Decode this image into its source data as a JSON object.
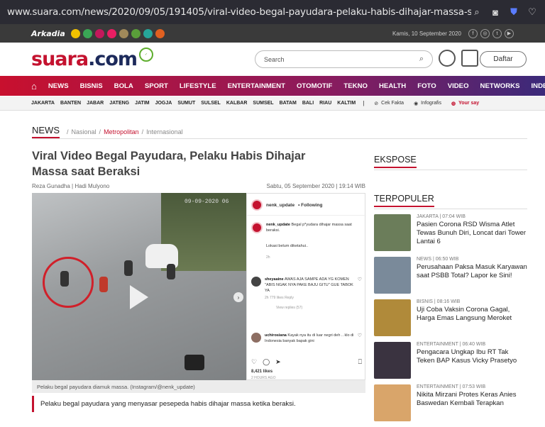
{
  "browser": {
    "url": "www.suara.com/news/2020/09/05/191405/viral-video-begal-payudara-pelaku-habis-dihajar-massa-saat-beraksi"
  },
  "topstrip": {
    "network": "Arkadia",
    "network_sub": "digital media",
    "date": "Kamis, 10 September 2020"
  },
  "header": {
    "logo_main": "suara",
    "logo_dot": ".com",
    "search_placeholder": "Search",
    "daftar_label": "Daftar"
  },
  "nav": {
    "items": [
      "NEWS",
      "BISNIS",
      "BOLA",
      "SPORT",
      "LIFESTYLE",
      "ENTERTAINMENT",
      "OTOMOTIF",
      "TEKNO",
      "HEALTH",
      "FOTO",
      "VIDEO",
      "NETWORKS",
      "INDEKS"
    ]
  },
  "subnav": {
    "regions": [
      "JAKARTA",
      "BANTEN",
      "JABAR",
      "JATENG",
      "JATIM",
      "JOGJA",
      "SUMUT",
      "SULSEL",
      "KALBAR",
      "SUMSEL",
      "BATAM",
      "BALI",
      "RIAU",
      "KALTIM"
    ],
    "cek_fakta": "Cek Fakta",
    "infografis": "Infografis",
    "your_say": "Your say"
  },
  "breadcrumb": {
    "main": "NEWS",
    "items": [
      "Nasional",
      "Metropolitan",
      "Internasional"
    ]
  },
  "article": {
    "title": "Viral Video Begal Payudara, Pelaku Habis Dihajar Massa saat Beraksi",
    "authors": "Reza Gunadha | Hadi Mulyono",
    "date": "Sabtu, 05 September 2020 | 19:14 WIB",
    "caption": "Pelaku begal payudara diamuk massa. (Instagram/@nenk_update)",
    "lead": "Pelaku begal payudara yang menyasar pesepeda habis dihajar massa ketika beraksi."
  },
  "instagram": {
    "account": "nenk_update",
    "follow": "• Following",
    "c1_user": "nenk_update",
    "c1_text": "Begal p*yudara dihajar massa saat beraksi.",
    "c1_more": "Lokasi belum diketahui..",
    "c1_time": "2h",
    "c2_user": "sheyaaine",
    "c2_text": "AWAS AJA SAMPE ADA YG KOMEN \"ABIS NGAK NYA PAKE BAJU GITU\" GUE TABOK YA",
    "c2_meta": "2h   779 likes   Reply",
    "c2_replies": "View replies (57)",
    "c3_user": "uchirosiana",
    "c3_text": "Kayak nya itu di luar negri deh .. klo di Indonesia banyak bapak gini",
    "likes": "8,421 likes",
    "ago": "2 HOURS AGO",
    "photo_stamp": "09-09-2020 06"
  },
  "sidebar": {
    "ekspose_label": "EKSPOSE",
    "terpopuler_label": "TERPOPULER",
    "items": [
      {
        "cat": "JAKARTA",
        "time": "| 07:04 WIB",
        "title": "Pasien Corona RSD Wisma Atlet Tewas Bunuh Diri, Loncat dari Tower Lantai 6",
        "color": "#6b7d5a"
      },
      {
        "cat": "NEWS",
        "time": "| 06:50 WIB",
        "title": "Perusahaan Paksa Masuk Karyawan saat PSBB Total? Lapor ke Sini!",
        "color": "#7a8a9a"
      },
      {
        "cat": "BISNIS",
        "time": "| 08:16 WIB",
        "title": "Uji Coba Vaksin Corona Gagal, Harga Emas Langsung Meroket",
        "color": "#b08a3a"
      },
      {
        "cat": "ENTERTAINMENT",
        "time": "| 06:40 WIB",
        "title": "Pengacara Ungkap Ibu RT Tak Teken BAP Kasus Vicky Prasetyo",
        "color": "#3a3340"
      },
      {
        "cat": "ENTERTAINMENT",
        "time": "| 07:53 WIB",
        "title": "Nikita Mirzani Protes Keras Anies Baswedan Kembali Terapkan",
        "color": "#d9a56a"
      }
    ]
  }
}
